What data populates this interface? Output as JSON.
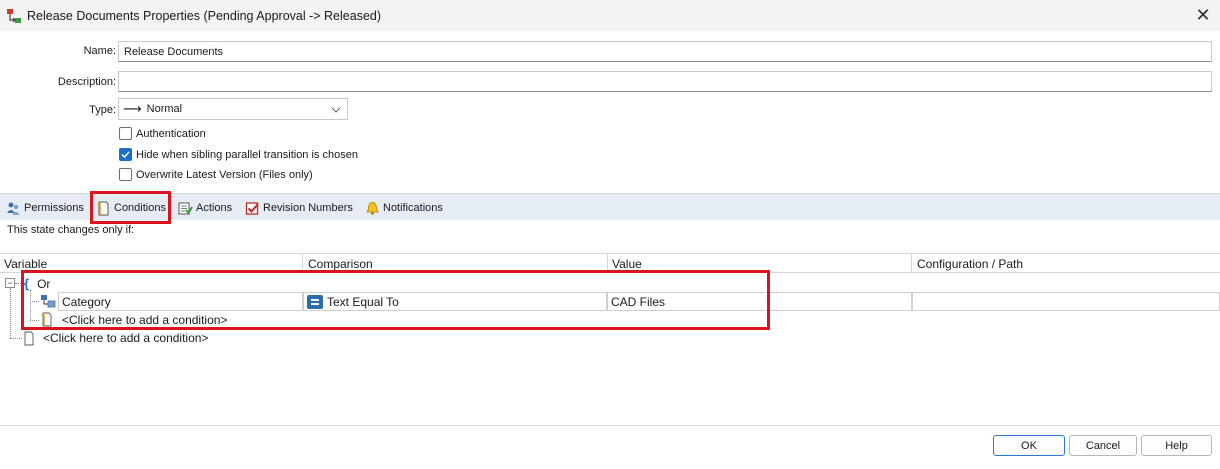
{
  "window": {
    "title": "Release Documents Properties (Pending Approval -> Released)",
    "icon": "workflow-transition-icon",
    "close_label": "✕"
  },
  "form": {
    "name_label": "Name:",
    "name_value": "Release Documents",
    "description_label": "Description:",
    "description_value": "",
    "type_label": "Type:",
    "type_value": "Normal",
    "type_arrow": "⟶",
    "authentication_label": "Authentication",
    "authentication_checked": false,
    "hide_sibling_label": "Hide when sibling parallel transition is chosen",
    "hide_sibling_checked": true,
    "overwrite_label": "Overwrite Latest Version (Files only)",
    "overwrite_checked": false
  },
  "tabs": [
    {
      "label": "Permissions",
      "icon": "users-icon"
    },
    {
      "label": "Conditions",
      "icon": "document-icon",
      "active": true
    },
    {
      "label": "Actions",
      "icon": "actions-icon"
    },
    {
      "label": "Revision Numbers",
      "icon": "checkbox-icon"
    },
    {
      "label": "Notifications",
      "icon": "bell-icon"
    }
  ],
  "conditions": {
    "subtitle": "This state changes only if:",
    "columns": [
      "Variable",
      "Comparison",
      "Value",
      "Configuration / Path"
    ],
    "group_label": "Or",
    "group_brace": "{",
    "rows": [
      {
        "variable": "Category",
        "comparison": "Text Equal To",
        "value": "CAD Files",
        "path": ""
      }
    ],
    "add_inner": "<Click here to add a condition>",
    "add_outer": "<Click here to add a condition>",
    "collapse_symbol": "−"
  },
  "buttons": {
    "ok": "OK",
    "cancel": "Cancel",
    "help": "Help"
  },
  "colors": {
    "highlight": "#d9141c",
    "accent": "#1a6fc9",
    "tabbar": "#e6ecf3"
  }
}
